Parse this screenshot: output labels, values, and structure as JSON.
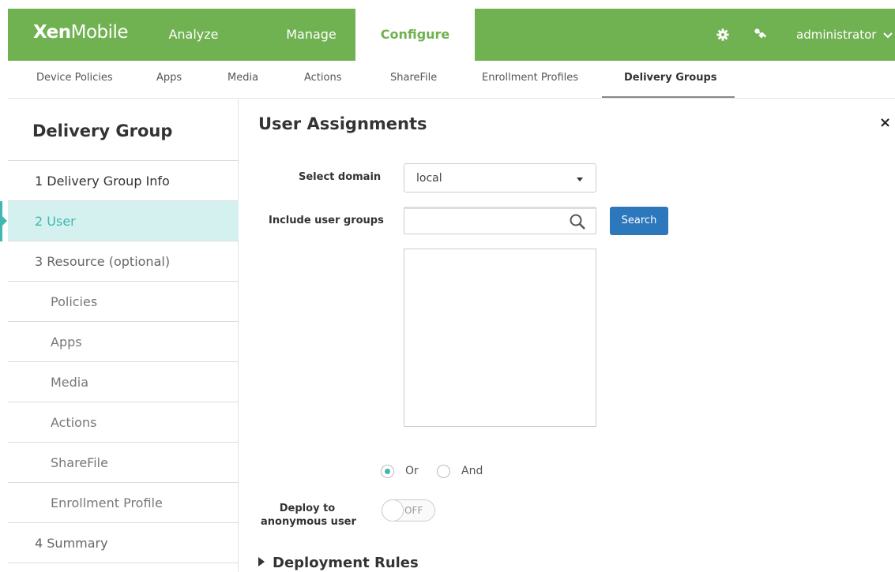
{
  "app": {
    "logo_bold": "Xen",
    "logo_light": "Mobile"
  },
  "topnav": {
    "items": [
      {
        "label": "Analyze"
      },
      {
        "label": "Manage"
      },
      {
        "label": "Configure"
      }
    ],
    "active": "Configure",
    "user": "administrator",
    "icons": [
      "gear-icon",
      "wrench-icon",
      "chevron-down-icon"
    ],
    "accent_color": "#70b151"
  },
  "subnav": {
    "items": [
      {
        "label": "Device Policies"
      },
      {
        "label": "Apps"
      },
      {
        "label": "Media"
      },
      {
        "label": "Actions"
      },
      {
        "label": "ShareFile"
      },
      {
        "label": "Enrollment Profiles"
      },
      {
        "label": "Delivery Groups"
      }
    ],
    "active": "Delivery Groups"
  },
  "sidebar": {
    "title": "Delivery Group",
    "items": [
      {
        "label": "1  Delivery Group Info"
      },
      {
        "label": "2  User"
      },
      {
        "label": "3  Resource (optional)"
      },
      {
        "label": "Policies"
      },
      {
        "label": "Apps"
      },
      {
        "label": "Media"
      },
      {
        "label": "Actions"
      },
      {
        "label": "ShareFile"
      },
      {
        "label": "Enrollment Profile"
      },
      {
        "label": "4  Summary"
      }
    ],
    "active": "2  User",
    "active_color": "#3fb8b1"
  },
  "main": {
    "title": "User Assignments",
    "close_label": "×",
    "select_domain_label": "Select domain",
    "domain_value": "local",
    "include_groups_label": "Include user groups",
    "search_value": "",
    "search_button": "Search",
    "or_label": "Or",
    "and_label": "And",
    "logic_selected": "Or",
    "deploy_label_line1": "Deploy to",
    "deploy_label_line2": "anonymous user",
    "toggle_state": "OFF",
    "deployment_rules": "Deployment Rules",
    "button_color": "#2d77bd"
  }
}
